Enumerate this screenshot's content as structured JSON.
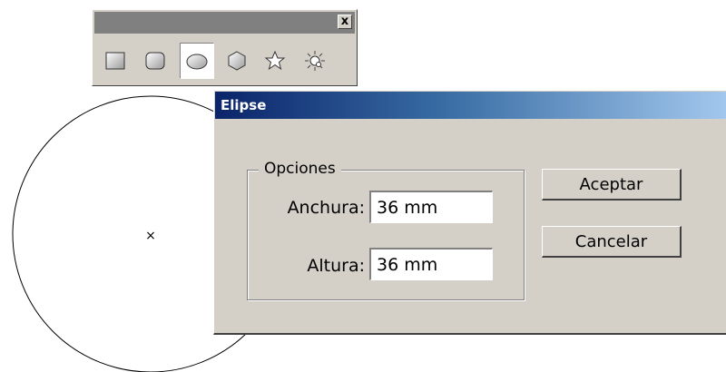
{
  "toolbar": {
    "close_label": "x",
    "tools": [
      {
        "icon": "rectangle-icon"
      },
      {
        "icon": "rounded-rectangle-icon"
      },
      {
        "icon": "ellipse-icon",
        "selected": true
      },
      {
        "icon": "polygon-icon"
      },
      {
        "icon": "star-icon"
      },
      {
        "icon": "flare-icon"
      }
    ]
  },
  "dialog": {
    "title": "Elipse",
    "group_label": "Opciones",
    "width_label": "Anchura:",
    "width_value": "36 mm",
    "height_label": "Altura:",
    "height_value": "36 mm",
    "ok_label": "Aceptar",
    "cancel_label": "Cancelar"
  },
  "canvas": {
    "center_mark": "×"
  },
  "colors": {
    "dialog_face": "#d4d0c8",
    "title_gradient_start": "#0a246a",
    "title_gradient_end": "#a6caf0"
  }
}
